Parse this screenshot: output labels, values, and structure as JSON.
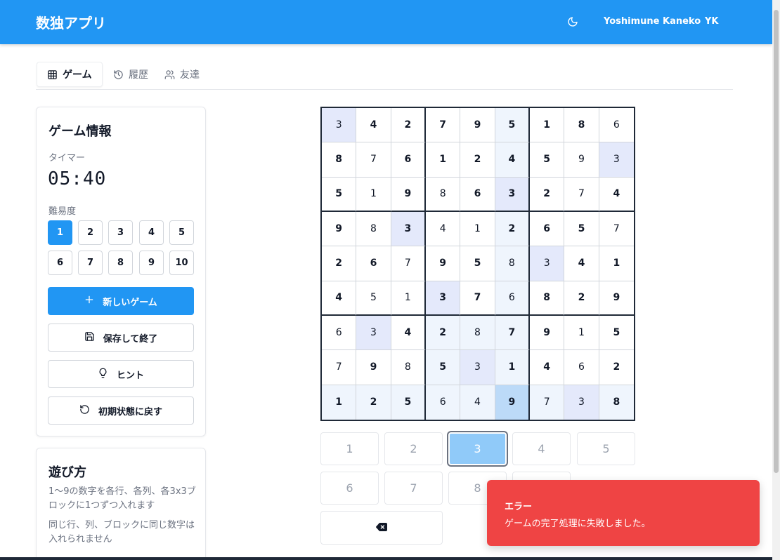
{
  "header": {
    "title": "数独アプリ",
    "user_name": "Yoshimune Kaneko",
    "user_initials": "YK"
  },
  "tabs": [
    {
      "label": "ゲーム",
      "icon": "grid-icon",
      "active": true
    },
    {
      "label": "履歴",
      "icon": "history-icon",
      "active": false
    },
    {
      "label": "友達",
      "icon": "users-icon",
      "active": false
    }
  ],
  "game_info": {
    "title": "ゲーム情報",
    "timer_label": "タイマー",
    "timer": "05:40",
    "difficulty_label": "難易度",
    "difficulty_levels": [
      "1",
      "2",
      "3",
      "4",
      "5",
      "6",
      "7",
      "8",
      "9",
      "10"
    ],
    "selected_difficulty": "1",
    "new_game_label": "新しいゲーム",
    "save_exit_label": "保存して終了",
    "hint_label": "ヒント",
    "reset_label": "初期状態に戻す"
  },
  "how_to_play": {
    "title": "遊び方",
    "lines": [
      "1〜9の数字を各行、各列、各3x3ブロックに1つずつ入れます",
      "同じ行、列、ブロックに同じ数字は入れられません"
    ]
  },
  "board": {
    "values": [
      [
        "3",
        "4",
        "2",
        "7",
        "9",
        "5",
        "1",
        "8",
        "6"
      ],
      [
        "8",
        "7",
        "6",
        "1",
        "2",
        "4",
        "5",
        "9",
        "3"
      ],
      [
        "5",
        "1",
        "9",
        "8",
        "6",
        "3",
        "2",
        "7",
        "4"
      ],
      [
        "9",
        "8",
        "3",
        "4",
        "1",
        "2",
        "6",
        "5",
        "7"
      ],
      [
        "2",
        "6",
        "7",
        "9",
        "5",
        "8",
        "3",
        "4",
        "1"
      ],
      [
        "4",
        "5",
        "1",
        "3",
        "7",
        "6",
        "8",
        "2",
        "9"
      ],
      [
        "6",
        "3",
        "4",
        "2",
        "8",
        "7",
        "9",
        "1",
        "5"
      ],
      [
        "7",
        "9",
        "8",
        "5",
        "3",
        "1",
        "4",
        "6",
        "2"
      ],
      [
        "1",
        "2",
        "5",
        "6",
        "4",
        "9",
        "7",
        "3",
        "8"
      ]
    ],
    "given": [
      [
        0,
        1,
        1,
        1,
        1,
        1,
        1,
        1,
        0
      ],
      [
        1,
        0,
        1,
        1,
        1,
        1,
        1,
        0,
        0
      ],
      [
        1,
        0,
        1,
        0,
        1,
        1,
        1,
        0,
        1
      ],
      [
        1,
        0,
        1,
        0,
        0,
        1,
        1,
        1,
        0
      ],
      [
        1,
        1,
        0,
        1,
        1,
        0,
        0,
        1,
        1
      ],
      [
        1,
        0,
        0,
        1,
        1,
        0,
        1,
        1,
        1
      ],
      [
        0,
        0,
        1,
        1,
        0,
        1,
        1,
        0,
        1
      ],
      [
        0,
        1,
        0,
        1,
        0,
        1,
        1,
        0,
        1
      ],
      [
        1,
        1,
        1,
        0,
        0,
        1,
        0,
        0,
        1
      ]
    ],
    "selected_cell": {
      "row": 8,
      "col": 5
    },
    "highlighted_number": "3"
  },
  "number_pad": {
    "numbers": [
      "1",
      "2",
      "3",
      "4",
      "5",
      "6",
      "7",
      "8"
    ],
    "active": "3",
    "erase_icon": "backspace-icon"
  },
  "toast": {
    "title": "エラー",
    "message": "ゲームの完了処理に失敗しました。"
  },
  "colors": {
    "primary": "#2196f3",
    "error": "#ef4444",
    "cell_selected": "#bcdaf8",
    "cell_same_number": "#e4e9fb",
    "cell_peer": "#eff5fd"
  }
}
